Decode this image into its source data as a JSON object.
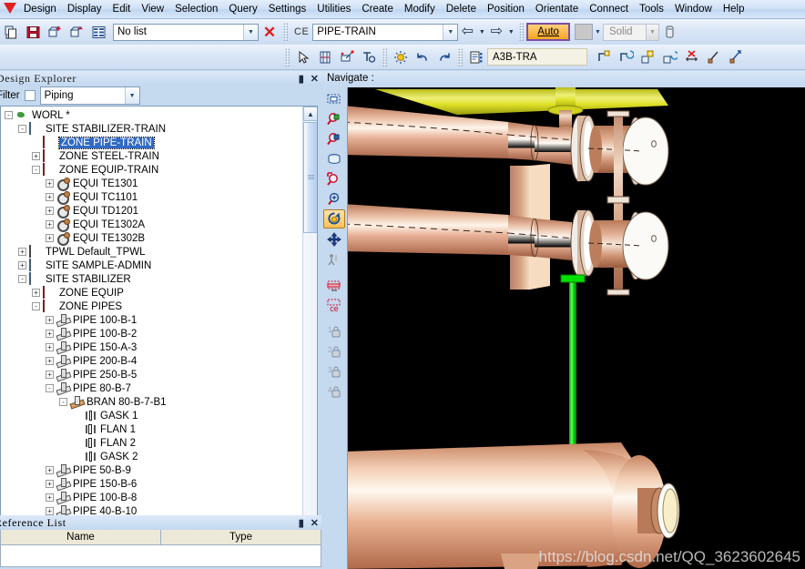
{
  "menu": {
    "items": [
      "Design",
      "Display",
      "Edit",
      "View",
      "Selection",
      "Query",
      "Settings",
      "Utilities",
      "Create",
      "Modify",
      "Delete",
      "Position",
      "Orientate",
      "Connect",
      "Tools",
      "Window",
      "Help"
    ]
  },
  "toolbar1": {
    "icons": [
      {
        "name": "copy-icon",
        "glyph": "copy"
      },
      {
        "name": "save-icon",
        "glyph": "save"
      },
      {
        "name": "add-to-list-icon",
        "glyph": "addlist"
      },
      {
        "name": "remove-from-list-icon",
        "glyph": "remlist"
      },
      {
        "name": "list-grid-icon",
        "glyph": "grid"
      }
    ],
    "list_combo_value": "No list",
    "clear_list_label": "✕",
    "ce_label": "CE",
    "ce_value": "PIPE-TRAIN",
    "back_label": "⇦",
    "forward_label": "⇨",
    "auto_button": "Auto",
    "representation_value": "Solid",
    "color_swatch": "#c8c8c8"
  },
  "toolbar2": {
    "a3b_value": "A3B-TRA",
    "icons": [
      {
        "name": "pick-arrow-icon"
      },
      {
        "name": "element-box-icon"
      },
      {
        "name": "element-axes-icon"
      },
      {
        "name": "text-tool-icon"
      },
      {
        "name": "highlight-sun-icon"
      },
      {
        "name": "undo-icon"
      },
      {
        "name": "redo-icon"
      },
      {
        "name": "list-document-icon"
      },
      {
        "name": "create-branch-icon"
      },
      {
        "name": "modify-branch-icon"
      },
      {
        "name": "create-component-icon"
      },
      {
        "name": "modify-component-icon"
      },
      {
        "name": "delete-component-icon"
      },
      {
        "name": "measure-point-icon"
      },
      {
        "name": "measure-distance-icon"
      }
    ]
  },
  "explorer": {
    "title": "Design Explorer",
    "pin_glyph": "▮",
    "close_glyph": "✕",
    "filter_label": "Filter",
    "filter_value": "Piping",
    "tree": [
      {
        "depth": 0,
        "toggle": "-",
        "icon": "world",
        "label": "WORL *",
        "selected": false
      },
      {
        "depth": 1,
        "toggle": "-",
        "icon": "site",
        "label": "SITE STABILIZER-TRAIN",
        "selected": false
      },
      {
        "depth": 2,
        "toggle": "",
        "icon": "zone",
        "label": "ZONE PIPE-TRAIN",
        "selected": true
      },
      {
        "depth": 2,
        "toggle": "+",
        "icon": "zone",
        "label": "ZONE STEEL-TRAIN",
        "selected": false
      },
      {
        "depth": 2,
        "toggle": "-",
        "icon": "zone",
        "label": "ZONE EQUIP-TRAIN",
        "selected": false
      },
      {
        "depth": 3,
        "toggle": "+",
        "icon": "equi",
        "label": "EQUI TE1301",
        "selected": false
      },
      {
        "depth": 3,
        "toggle": "+",
        "icon": "equi",
        "label": "EQUI TC1101",
        "selected": false
      },
      {
        "depth": 3,
        "toggle": "+",
        "icon": "equi",
        "label": "EQUI TD1201",
        "selected": false
      },
      {
        "depth": 3,
        "toggle": "+",
        "icon": "equi",
        "label": "EQUI TE1302A",
        "selected": false
      },
      {
        "depth": 3,
        "toggle": "+",
        "icon": "equi",
        "label": "EQUI TE1302B",
        "selected": false
      },
      {
        "depth": 1,
        "toggle": "+",
        "icon": "tpwl",
        "label": "TPWL Default_TPWL",
        "selected": false
      },
      {
        "depth": 1,
        "toggle": "+",
        "icon": "site",
        "label": "SITE SAMPLE-ADMIN",
        "selected": false
      },
      {
        "depth": 1,
        "toggle": "-",
        "icon": "site",
        "label": "SITE STABILIZER",
        "selected": false
      },
      {
        "depth": 2,
        "toggle": "+",
        "icon": "zone",
        "label": "ZONE EQUIP",
        "selected": false
      },
      {
        "depth": 2,
        "toggle": "-",
        "icon": "zone",
        "label": "ZONE PIPES",
        "selected": false
      },
      {
        "depth": 3,
        "toggle": "+",
        "icon": "pipe",
        "label": "PIPE 100-B-1",
        "selected": false
      },
      {
        "depth": 3,
        "toggle": "+",
        "icon": "pipe",
        "label": "PIPE 100-B-2",
        "selected": false
      },
      {
        "depth": 3,
        "toggle": "+",
        "icon": "pipe",
        "label": "PIPE 150-A-3",
        "selected": false
      },
      {
        "depth": 3,
        "toggle": "+",
        "icon": "pipe",
        "label": "PIPE 200-B-4",
        "selected": false
      },
      {
        "depth": 3,
        "toggle": "+",
        "icon": "pipe",
        "label": "PIPE 250-B-5",
        "selected": false
      },
      {
        "depth": 3,
        "toggle": "-",
        "icon": "pipe",
        "label": "PIPE 80-B-7",
        "selected": false
      },
      {
        "depth": 4,
        "toggle": "-",
        "icon": "bran",
        "label": "BRAN 80-B-7-B1",
        "selected": false
      },
      {
        "depth": 5,
        "toggle": "",
        "icon": "gask",
        "label": "GASK 1",
        "selected": false
      },
      {
        "depth": 5,
        "toggle": "",
        "icon": "flan",
        "label": "FLAN 1",
        "selected": false
      },
      {
        "depth": 5,
        "toggle": "",
        "icon": "flan",
        "label": "FLAN 2",
        "selected": false
      },
      {
        "depth": 5,
        "toggle": "",
        "icon": "gask",
        "label": "GASK 2",
        "selected": false
      },
      {
        "depth": 3,
        "toggle": "+",
        "icon": "pipe",
        "label": "PIPE 50-B-9",
        "selected": false
      },
      {
        "depth": 3,
        "toggle": "+",
        "icon": "pipe",
        "label": "PIPE 150-B-6",
        "selected": false
      },
      {
        "depth": 3,
        "toggle": "+",
        "icon": "pipe",
        "label": "PIPE 100-B-8",
        "selected": false
      },
      {
        "depth": 3,
        "toggle": "+",
        "icon": "pipe",
        "label": "PIPE 40-B-10",
        "selected": false
      }
    ]
  },
  "reference_list": {
    "title": "Reference List",
    "pin_glyph": "▮",
    "close_glyph": "✕",
    "columns": [
      "Name",
      "Type"
    ]
  },
  "viewport": {
    "title": "Navigate :",
    "watermark": "https://blog.csdn.net/QQ_3623602645",
    "background": "#000000",
    "nav_icons": [
      {
        "name": "view-limits-icon",
        "active": false
      },
      {
        "name": "zoom-to-selection-icon",
        "active": false
      },
      {
        "name": "zoom-to-element-icon",
        "active": false
      },
      {
        "name": "view-all-icon",
        "active": false
      },
      {
        "name": "zoom-area-icon",
        "active": false
      },
      {
        "name": "zoom-in-icon",
        "active": false
      },
      {
        "name": "rotate-icon",
        "active": true
      },
      {
        "name": "pan-icon",
        "active": false
      },
      {
        "name": "walk-icon",
        "active": false
      },
      {
        "name": "view-plan-icon",
        "active": false
      },
      {
        "name": "center-on-ce-icon",
        "active": false
      },
      {
        "name": "saved-view-1-icon",
        "active": false
      },
      {
        "name": "saved-view-2-icon",
        "active": false
      },
      {
        "name": "saved-view-3-icon",
        "active": false
      },
      {
        "name": "saved-view-4-icon",
        "active": false
      }
    ],
    "scene": {
      "pipe_color": "#d9a384",
      "highlight_color": "#00e000",
      "yellow_pipe_color": "#d9dd1e",
      "vessel_color": "#e0a98a"
    }
  }
}
